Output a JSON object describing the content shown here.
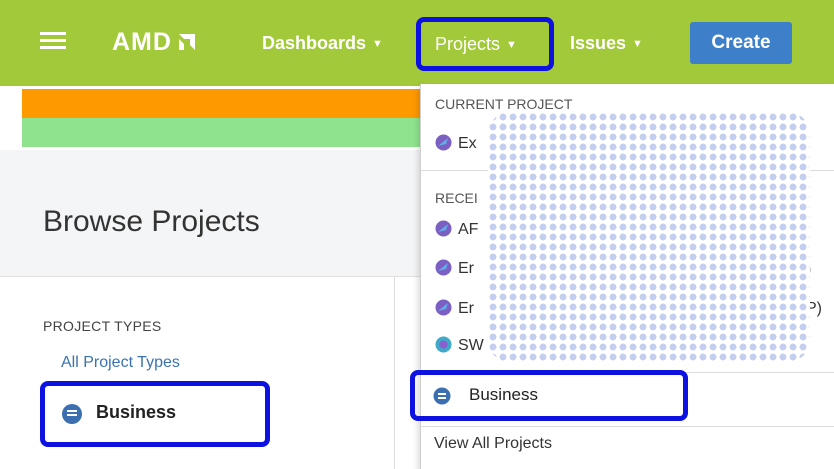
{
  "navbar": {
    "logo_text": "AMD",
    "items": [
      {
        "label": "Dashboards"
      },
      {
        "label": "Projects"
      },
      {
        "label": "Issues"
      }
    ],
    "create_label": "Create",
    "background_color": "#a2c93a"
  },
  "page": {
    "title": "Browse Projects",
    "project_types_heading": "PROJECT TYPES",
    "all_types_link": "All Project Types",
    "business_type": "Business"
  },
  "dropdown": {
    "current_heading": "CURRENT PROJECT",
    "current_item": "Ex",
    "recent_heading": "RECEI",
    "recent_items": [
      {
        "label": "AF",
        "icon": "project-avatar-icon"
      },
      {
        "label": "Er",
        "icon": "project-avatar-icon",
        "suffix": ")"
      },
      {
        "label": "Er",
        "icon": "project-avatar-icon",
        "suffix": "P)"
      },
      {
        "label": "SW",
        "icon": "sw-avatar-icon"
      }
    ],
    "business_label": "Business",
    "view_all_label": "View All Projects"
  },
  "colors": {
    "highlight_box": "#0d12e0",
    "create_button": "#3e7fc9",
    "stripe_orange": "#ff9900",
    "stripe_green": "#8fe38f",
    "link": "#3b73af"
  }
}
